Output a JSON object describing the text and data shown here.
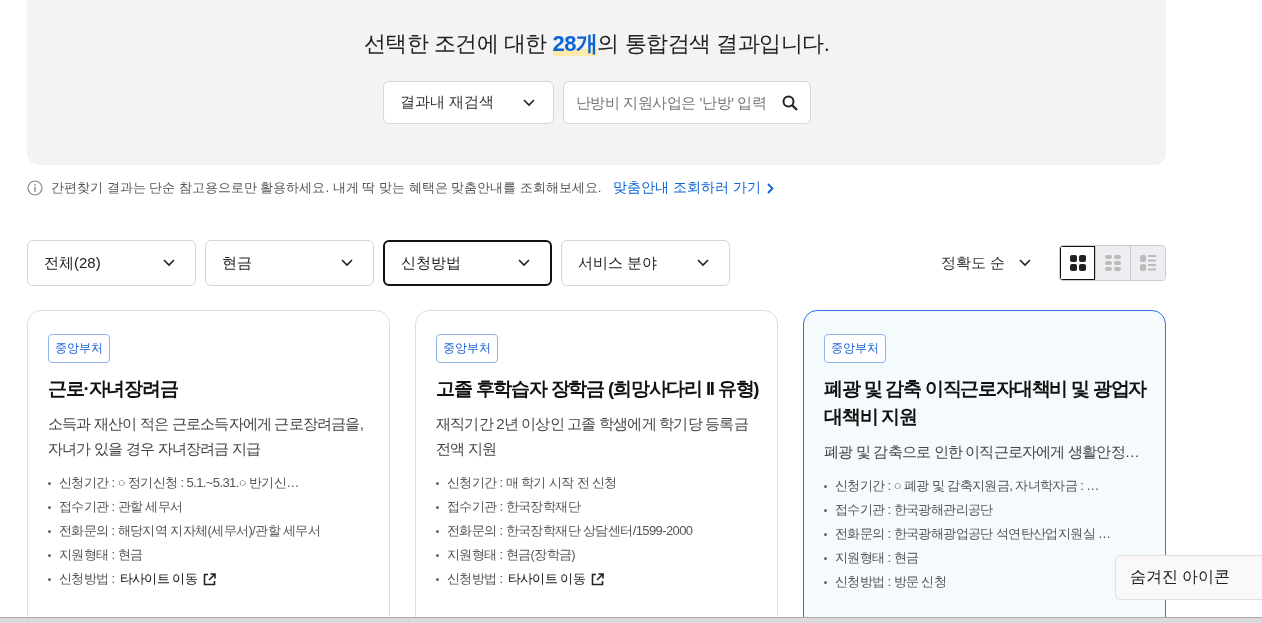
{
  "summary": {
    "before": "선택한 조건에 대한 ",
    "count": "28개",
    "after": "의 통합검색 결과입니다."
  },
  "research": {
    "scope": "결과내 재검색",
    "placeholder": "난방비 지원사업은 '난방' 입력"
  },
  "notice": {
    "text": "간편찾기 결과는 단순 참고용으로만 활용하세요. 내게 딱 맞는 혜택은 맞춤안내를 조회해보세요.",
    "link": "맞춤안내 조회하러 가기"
  },
  "filters": [
    {
      "label": "전체(28)",
      "selected": false
    },
    {
      "label": "현금",
      "selected": false
    },
    {
      "label": "신청방법",
      "selected": true
    },
    {
      "label": "서비스 분야",
      "selected": false
    }
  ],
  "sort": {
    "label": "정확도 순"
  },
  "views": [
    {
      "kind": "grid",
      "selected": true
    },
    {
      "kind": "compact",
      "selected": false
    },
    {
      "kind": "list",
      "selected": false
    }
  ],
  "cards": [
    {
      "tag": "중앙부처",
      "title": "근로·자녀장려금",
      "description": "소득과 재산이 적은 근로소득자에게 근로장려금을, 자녀가 있을 경우 자녀장려금 지급",
      "selected": false,
      "details": [
        {
          "label": "신청기간 :",
          "value": "○ 정기신청 : 5.1.~5.31.○ 반기신…",
          "kind": "text"
        },
        {
          "label": "접수기관 :",
          "value": "관할 세무서",
          "kind": "text"
        },
        {
          "label": "전화문의 :",
          "value": "해당지역 지자체(세무서)/관할 세무서",
          "kind": "text"
        },
        {
          "label": "지원형태 :",
          "value": "현금",
          "kind": "text"
        },
        {
          "label": "신청방법 :",
          "value": "타사이트 이동",
          "kind": "link"
        }
      ]
    },
    {
      "tag": "중앙부처",
      "title": "고졸 후학습자 장학금 (희망사다리 II 유형)",
      "description": "재직기간 2년 이상인 고졸 학생에게 학기당 등록금 전액 지원",
      "selected": false,
      "details": [
        {
          "label": "신청기간 :",
          "value": "매 학기 시작 전 신청",
          "kind": "text"
        },
        {
          "label": "접수기관 :",
          "value": "한국장학재단",
          "kind": "text"
        },
        {
          "label": "전화문의 :",
          "value": "한국장학재단 상담센터/1599-2000",
          "kind": "text"
        },
        {
          "label": "지원형태 :",
          "value": "현금(장학금)",
          "kind": "text"
        },
        {
          "label": "신청방법 :",
          "value": "타사이트 이동",
          "kind": "link"
        }
      ]
    },
    {
      "tag": "중앙부처",
      "title": "폐광 및 감축 이직근로자대책비 및 광업자 대책비 지원",
      "description": "폐광 및 감축으로 인한 이직근로자에게 생활안정…",
      "selected": true,
      "details": [
        {
          "label": "신청기간 :",
          "value": "○ 폐광 및 감축지원금, 자녀학자금 : …",
          "kind": "text"
        },
        {
          "label": "접수기관 :",
          "value": "한국광해관리공단",
          "kind": "text"
        },
        {
          "label": "전화문의 :",
          "value": "한국광해광업공단 석연탄산업지원실 …",
          "kind": "text"
        },
        {
          "label": "지원형태 :",
          "value": "현금",
          "kind": "text"
        },
        {
          "label": "신청방법 :",
          "value": "방문 신청",
          "kind": "text"
        }
      ]
    }
  ],
  "tooltip": {
    "text": "숨겨진 아이콘"
  }
}
